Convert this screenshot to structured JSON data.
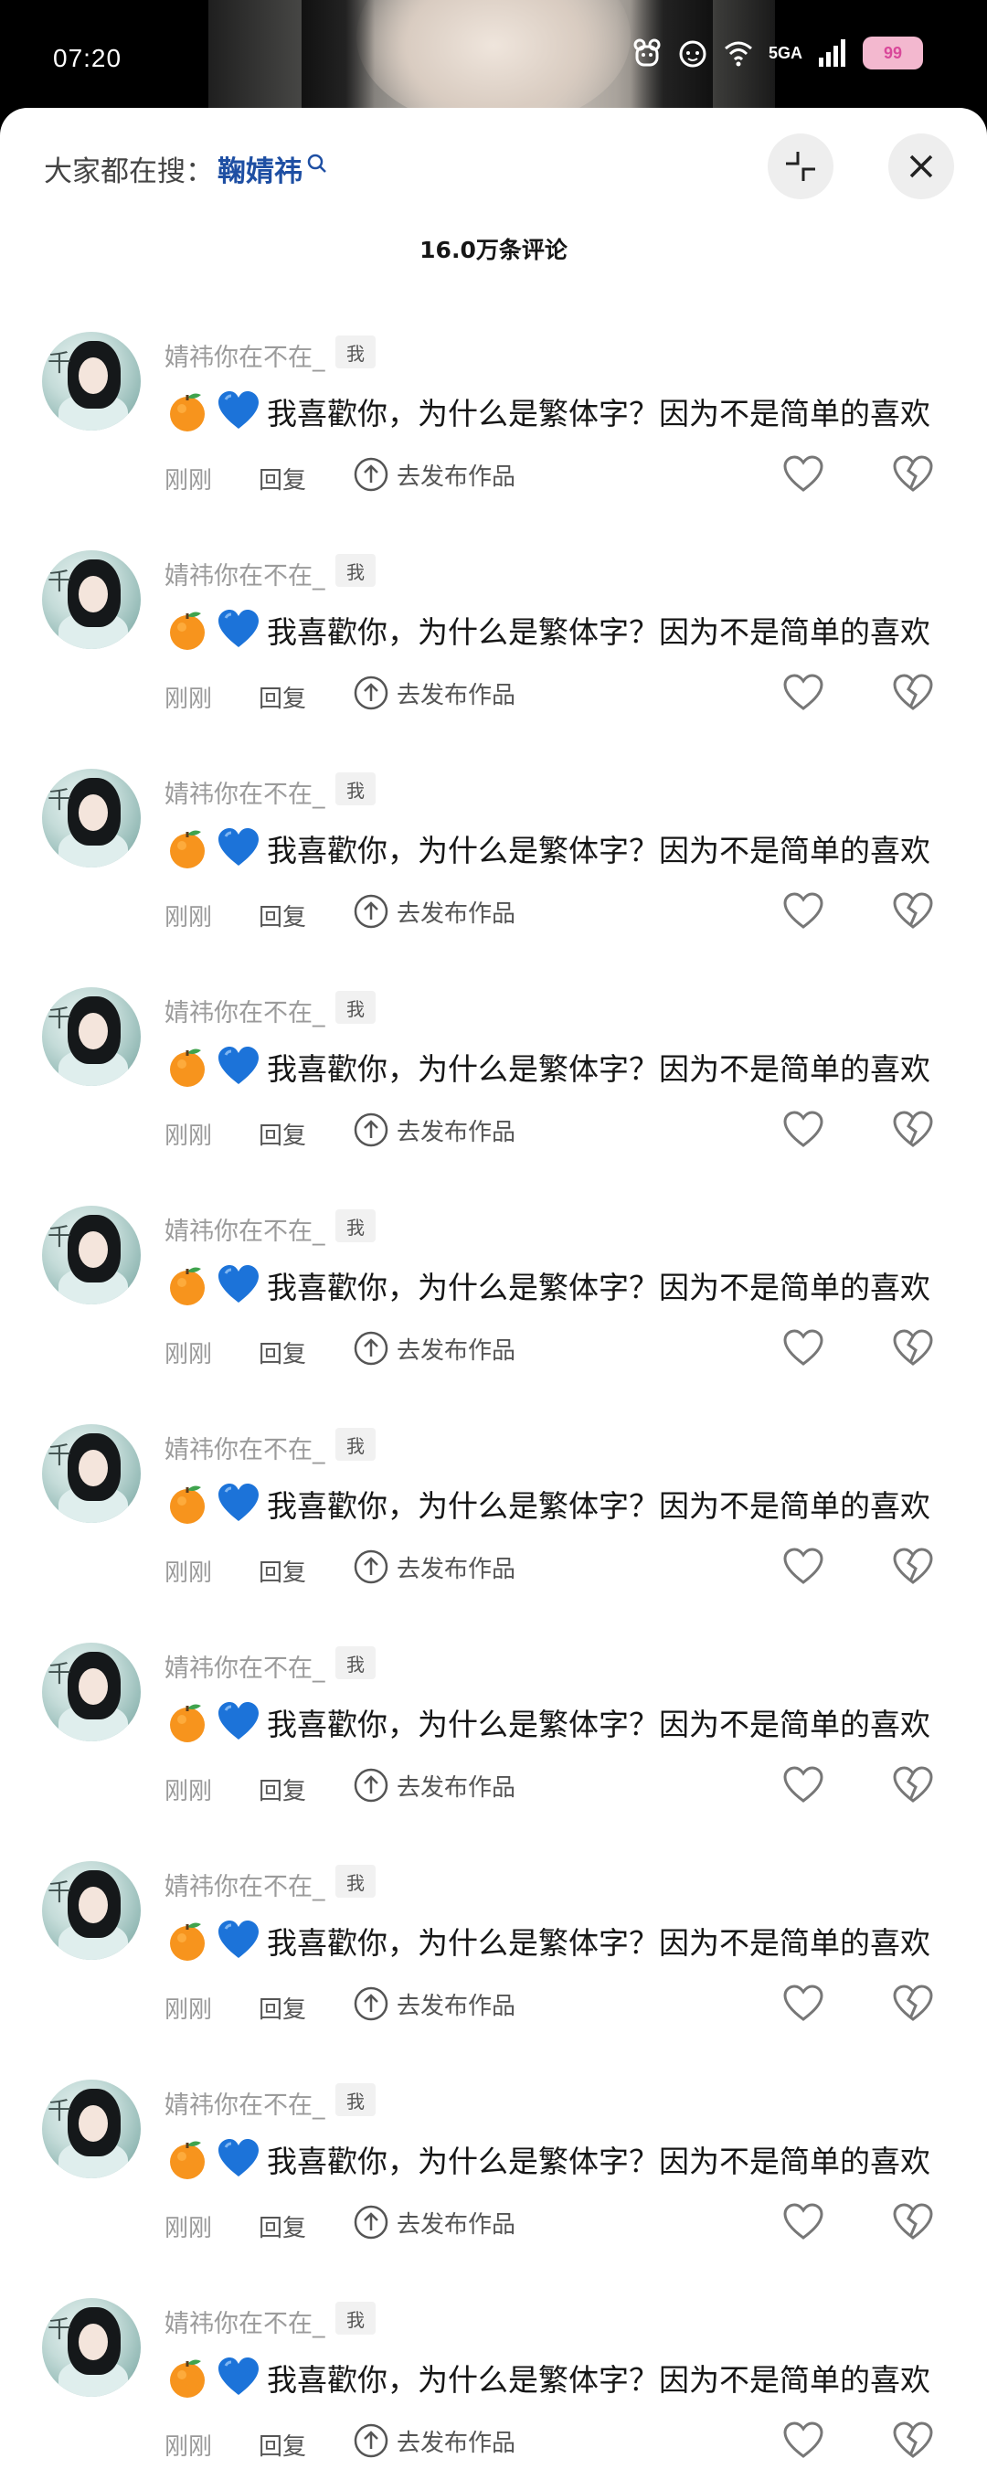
{
  "status_bar": {
    "time": "07:20",
    "network": "5GA",
    "battery": "99"
  },
  "header": {
    "search_prefix": "大家都在搜：",
    "search_term": "鞠婧祎"
  },
  "comment_count": "16.0万条评论",
  "comments": [
    {
      "username": "婧祎你在不在_",
      "badge": "我",
      "text": "我喜歡你，为什么是繁体字？因为不是简单的喜欢",
      "time": "刚刚",
      "reply": "回复",
      "publish": "去发布作品"
    },
    {
      "username": "婧祎你在不在_",
      "badge": "我",
      "text": "我喜歡你，为什么是繁体字？因为不是简单的喜欢",
      "time": "刚刚",
      "reply": "回复",
      "publish": "去发布作品"
    },
    {
      "username": "婧祎你在不在_",
      "badge": "我",
      "text": "我喜歡你，为什么是繁体字？因为不是简单的喜欢",
      "time": "刚刚",
      "reply": "回复",
      "publish": "去发布作品"
    },
    {
      "username": "婧祎你在不在_",
      "badge": "我",
      "text": "我喜歡你，为什么是繁体字？因为不是简单的喜欢",
      "time": "刚刚",
      "reply": "回复",
      "publish": "去发布作品"
    },
    {
      "username": "婧祎你在不在_",
      "badge": "我",
      "text": "我喜歡你，为什么是繁体字？因为不是简单的喜欢",
      "time": "刚刚",
      "reply": "回复",
      "publish": "去发布作品"
    },
    {
      "username": "婧祎你在不在_",
      "badge": "我",
      "text": "我喜歡你，为什么是繁体字？因为不是简单的喜欢",
      "time": "刚刚",
      "reply": "回复",
      "publish": "去发布作品"
    },
    {
      "username": "婧祎你在不在_",
      "badge": "我",
      "text": "我喜歡你，为什么是繁体字？因为不是简单的喜欢",
      "time": "刚刚",
      "reply": "回复",
      "publish": "去发布作品"
    },
    {
      "username": "婧祎你在不在_",
      "badge": "我",
      "text": "我喜歡你，为什么是繁体字？因为不是简单的喜欢",
      "time": "刚刚",
      "reply": "回复",
      "publish": "去发布作品"
    },
    {
      "username": "婧祎你在不在_",
      "badge": "我",
      "text": "我喜歡你，为什么是繁体字？因为不是简单的喜欢",
      "time": "刚刚",
      "reply": "回复",
      "publish": "去发布作品"
    },
    {
      "username": "婧祎你在不在_",
      "badge": "我",
      "text": "我喜歡你，为什么是繁体字？因为不是简单的喜欢",
      "time": "刚刚",
      "reply": "回复",
      "publish": "去发布作品"
    }
  ],
  "icons": {
    "emoji_1": "tangerine-emoji",
    "emoji_2": "blue-heart-emoji",
    "like": "heart-outline-icon",
    "dislike": "broken-heart-icon",
    "publish": "upload-circle-icon",
    "collapse": "collapse-arrows-icon",
    "close": "close-icon",
    "search": "search-icon"
  },
  "colors": {
    "search_term": "#1e4fa3",
    "battery_bg": "#f3b8cf",
    "battery_text": "#d9489a"
  }
}
